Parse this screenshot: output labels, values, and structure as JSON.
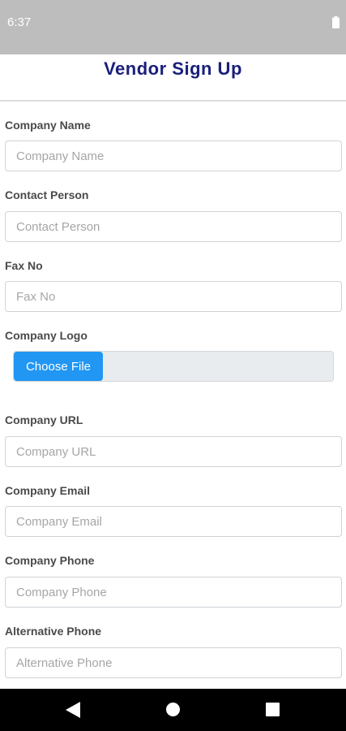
{
  "status_bar": {
    "time": "6:37",
    "icons": [
      "battery-icon"
    ]
  },
  "header": {
    "title": "Vendor Sign Up",
    "title_color": "#1a1f7a"
  },
  "form": {
    "company_name": {
      "label": "Company Name",
      "placeholder": "Company Name",
      "value": ""
    },
    "contact_person": {
      "label": "Contact Person",
      "placeholder": "Contact Person",
      "value": ""
    },
    "fax_no": {
      "label": "Fax No",
      "placeholder": "Fax No",
      "value": ""
    },
    "company_logo": {
      "label": "Company Logo",
      "button_label": "Choose File"
    },
    "company_url": {
      "label": "Company URL",
      "placeholder": "Company URL",
      "value": ""
    },
    "company_email": {
      "label": "Company Email",
      "placeholder": "Company Email",
      "value": ""
    },
    "company_phone": {
      "label": "Company Phone",
      "placeholder": "Company Phone",
      "value": ""
    },
    "alternative_phone": {
      "label": "Alternative Phone",
      "placeholder": "Alternative Phone",
      "value": ""
    }
  },
  "colors": {
    "accent": "#2196f3",
    "status_bar": "#bdbdbd",
    "nav_bar": "#000000"
  },
  "nav_bar": {
    "icons": [
      "back-icon",
      "home-icon",
      "recents-icon"
    ]
  }
}
